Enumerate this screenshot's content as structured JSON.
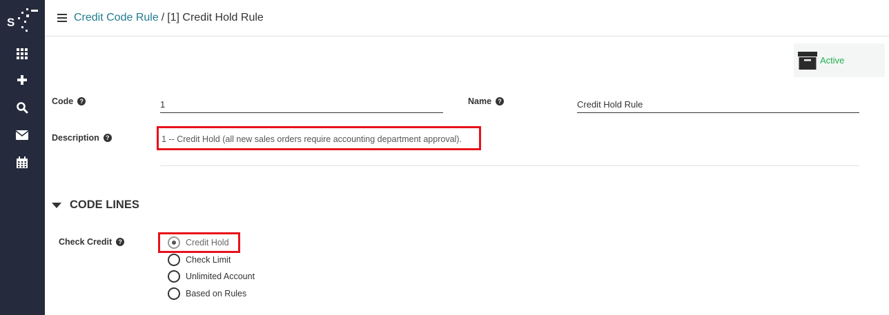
{
  "sidebar": {
    "logo_letter": "S",
    "items": [
      {
        "icon": "apps-grid-icon"
      },
      {
        "icon": "plus-icon"
      },
      {
        "icon": "search-icon"
      },
      {
        "icon": "mail-icon"
      },
      {
        "icon": "calendar-icon"
      }
    ]
  },
  "header": {
    "breadcrumb_parent": "Credit Code Rule",
    "breadcrumb_separator": "/",
    "breadcrumb_current": "[1] Credit Hold Rule"
  },
  "status": {
    "label": "Active",
    "color": "#21b04b"
  },
  "form": {
    "code_label": "Code",
    "code_value": "1",
    "name_label": "Name",
    "name_value": "Credit Hold Rule",
    "description_label": "Description",
    "description_value": "1 -- Credit Hold (all new sales orders require accounting department approval)."
  },
  "code_lines": {
    "section_title": "CODE LINES",
    "check_credit_label": "Check Credit",
    "options": [
      {
        "label": "Credit Hold",
        "checked": true
      },
      {
        "label": "Check Limit",
        "checked": false
      },
      {
        "label": "Unlimited Account",
        "checked": false
      },
      {
        "label": "Based on Rules",
        "checked": false
      }
    ]
  },
  "colors": {
    "sidebar_bg": "#252b3d",
    "link": "#217c8f",
    "highlight": "#e8111a"
  }
}
